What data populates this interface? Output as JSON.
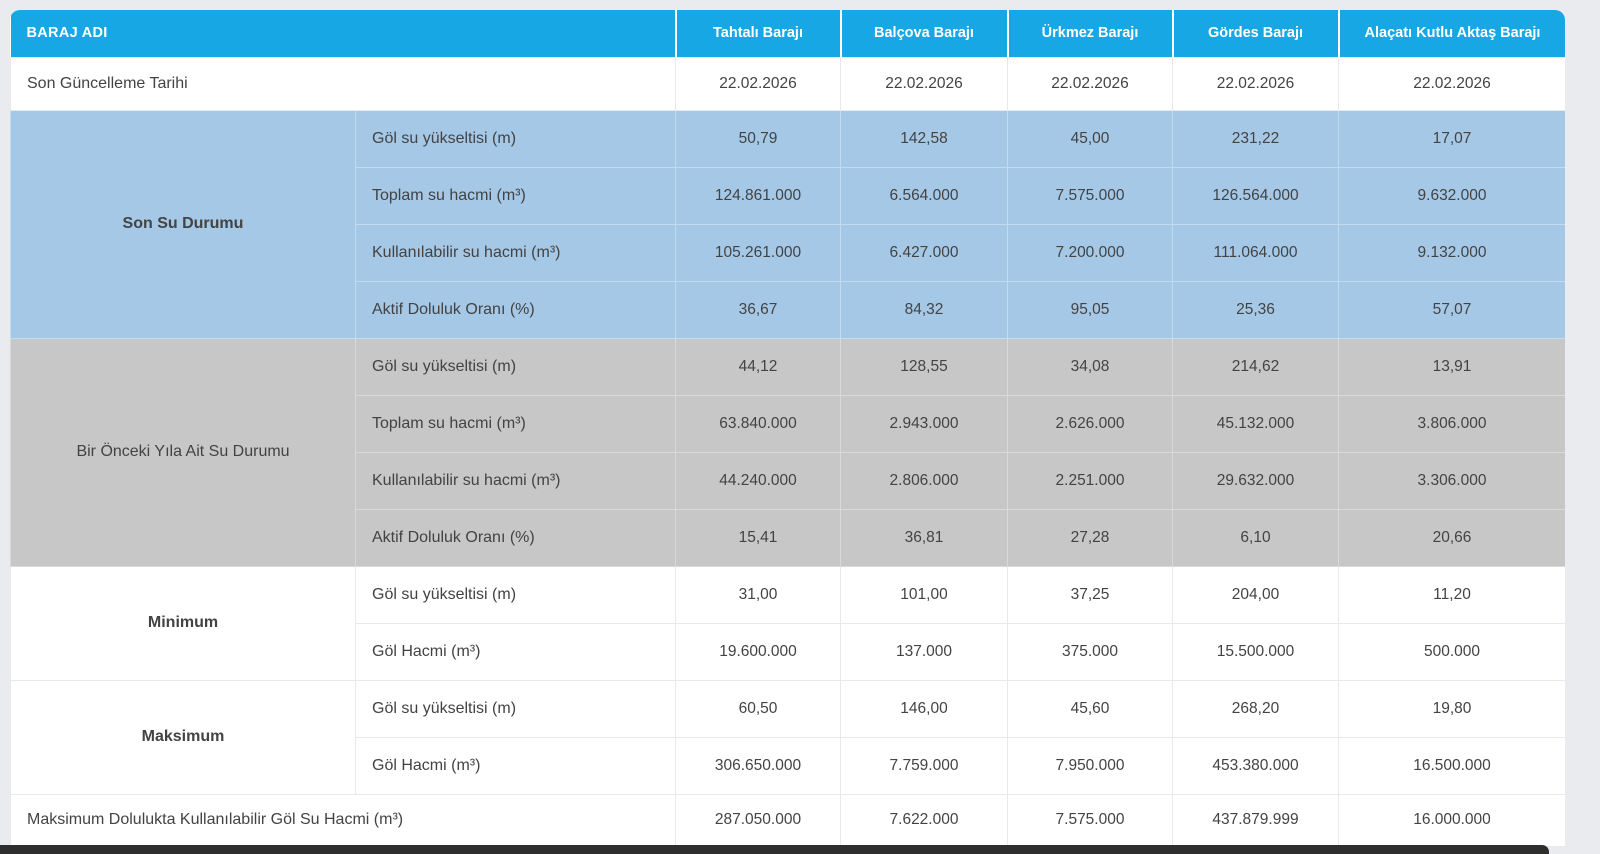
{
  "colors": {
    "header_blue": "#18a7e5",
    "section_blue": "#a5c8e6",
    "section_gray": "#c6c7c6",
    "page_background": "#e9ebee",
    "bottom_bar": "#2e2e2e"
  },
  "table": {
    "header": {
      "label": "BARAJ ADI",
      "columns": [
        "Tahtalı Barajı",
        "Balçova Barajı",
        "Ürkmez Barajı",
        "Gördes Barajı",
        "Alaçatı Kutlu Aktaş Barajı"
      ]
    },
    "update_row": {
      "label": "Son Güncelleme Tarihi",
      "values": [
        "22.02.2026",
        "22.02.2026",
        "22.02.2026",
        "22.02.2026",
        "22.02.2026"
      ]
    },
    "sections": [
      {
        "title": "Son Su Durumu",
        "rows": [
          {
            "label": "Göl su yükseltisi (m)",
            "values": [
              "50,79",
              "142,58",
              "45,00",
              "231,22",
              "17,07"
            ]
          },
          {
            "label": "Toplam su hacmi (m³)",
            "values": [
              "124.861.000",
              "6.564.000",
              "7.575.000",
              "126.564.000",
              "9.632.000"
            ]
          },
          {
            "label": "Kullanılabilir su hacmi (m³)",
            "values": [
              "105.261.000",
              "6.427.000",
              "7.200.000",
              "111.064.000",
              "9.132.000"
            ]
          },
          {
            "label": "Aktif Doluluk Oranı (%)",
            "values": [
              "36,67",
              "84,32",
              "95,05",
              "25,36",
              "57,07"
            ]
          }
        ]
      },
      {
        "title": "Bir Önceki Yıla Ait Su Durumu",
        "rows": [
          {
            "label": "Göl su yükseltisi (m)",
            "values": [
              "44,12",
              "128,55",
              "34,08",
              "214,62",
              "13,91"
            ]
          },
          {
            "label": "Toplam su hacmi (m³)",
            "values": [
              "63.840.000",
              "2.943.000",
              "2.626.000",
              "45.132.000",
              "3.806.000"
            ]
          },
          {
            "label": "Kullanılabilir su hacmi (m³)",
            "values": [
              "44.240.000",
              "2.806.000",
              "2.251.000",
              "29.632.000",
              "3.306.000"
            ]
          },
          {
            "label": "Aktif Doluluk Oranı (%)",
            "values": [
              "15,41",
              "36,81",
              "27,28",
              "6,10",
              "20,66"
            ]
          }
        ]
      },
      {
        "title": "Minimum",
        "rows": [
          {
            "label": "Göl su yükseltisi (m)",
            "values": [
              "31,00",
              "101,00",
              "37,25",
              "204,00",
              "11,20"
            ]
          },
          {
            "label": "Göl Hacmi (m³)",
            "values": [
              "19.600.000",
              "137.000",
              "375.000",
              "15.500.000",
              "500.000"
            ]
          }
        ]
      },
      {
        "title": "Maksimum",
        "rows": [
          {
            "label": "Göl su yükseltisi (m)",
            "values": [
              "60,50",
              "146,00",
              "45,60",
              "268,20",
              "19,80"
            ]
          },
          {
            "label": "Göl Hacmi (m³)",
            "values": [
              "306.650.000",
              "7.759.000",
              "7.950.000",
              "453.380.000",
              "16.500.000"
            ]
          }
        ]
      }
    ],
    "footer_row": {
      "label": "Maksimum Dolulukta Kullanılabilir Göl Su Hacmi (m³)",
      "values": [
        "287.050.000",
        "7.622.000",
        "7.575.000",
        "437.879.999",
        "16.000.000"
      ]
    }
  }
}
